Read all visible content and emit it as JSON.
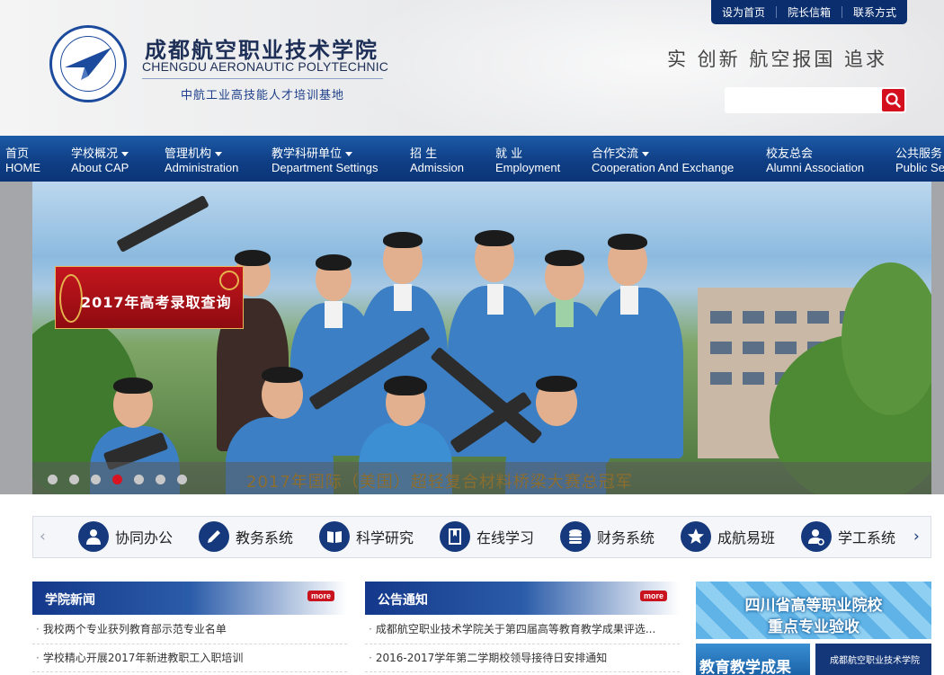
{
  "header": {
    "top_links": [
      "设为首页",
      "院长信箱",
      "联系方式"
    ],
    "logo_cn": "成都航空职业技术学院",
    "logo_en": "CHENGDU AERONAUTIC POLYTECHNIC",
    "logo_sub": "中航工业高技能人才培训基地",
    "motto": "实  创新  航空报国 追求",
    "search_placeholder": ""
  },
  "nav": [
    {
      "cn": "首页",
      "en": "HOME",
      "dropdown": false
    },
    {
      "cn": "学校概况",
      "en": "About CAP",
      "dropdown": true
    },
    {
      "cn": "管理机构",
      "en": "Administration",
      "dropdown": true
    },
    {
      "cn": "教学科研单位",
      "en": "Department Settings",
      "dropdown": true
    },
    {
      "cn": "招 生",
      "en": "Admission",
      "dropdown": false
    },
    {
      "cn": "就 业",
      "en": "Employment",
      "dropdown": false
    },
    {
      "cn": "合作交流",
      "en": "Cooperation And Exchange",
      "dropdown": true
    },
    {
      "cn": "校友总会",
      "en": "Alumni Association",
      "dropdown": false
    },
    {
      "cn": "公共服务",
      "en": "Public Service",
      "dropdown": false
    }
  ],
  "banner": {
    "promo_label": "2017年高考录取查询",
    "caption": "2017年国际（美国）超轻复合材料桥梁大赛总冠军",
    "slide_count": 7,
    "active_slide": 4
  },
  "quick_links": [
    "协同办公",
    "教务系统",
    "科学研究",
    "在线学习",
    "财务系统",
    "成航易班",
    "学工系统"
  ],
  "quick_icons": [
    "users-icon",
    "pencil-icon",
    "book-icon",
    "bookmark-icon",
    "coins-icon",
    "star-icon",
    "student-icon"
  ],
  "news": {
    "title": "学院新闻",
    "more": "more",
    "items": [
      "我校两个专业获列教育部示范专业名单",
      "学校精心开展2017年新进教职工入职培训"
    ]
  },
  "notices": {
    "title": "公告通知",
    "more": "more",
    "items": [
      "成都航空职业技术学院关于第四届高等教育教学成果评选...",
      "2016-2017学年第二学期校领导接待日安排通知"
    ]
  },
  "side": {
    "banner1_line1": "四川省高等职业院校",
    "banner1_line2": "重点专业验收",
    "banner2": "教育教学成果",
    "banner3": "成都航空职业技术学院"
  },
  "colors": {
    "nav_blue": "#0f3f86",
    "accent_red": "#d71420",
    "dark_blue": "#15397c"
  }
}
